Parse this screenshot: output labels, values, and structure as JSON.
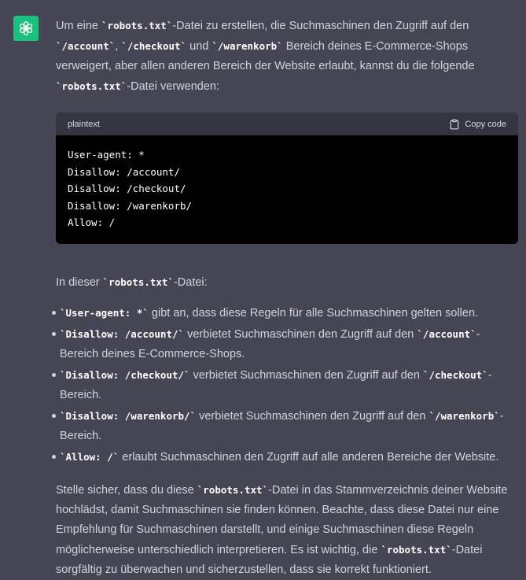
{
  "message": {
    "intro": {
      "t1": "Um eine ",
      "c1": "`robots.txt`",
      "t2": "-Datei zu erstellen, die Suchmaschinen den Zugriff auf den ",
      "c2": "`/account`",
      "t3": ", ",
      "c3": "`/checkout`",
      "t4": " und ",
      "c4": "`/warenkorb`",
      "t5": " Bereich deines E-Commerce-Shops verweigert, aber allen anderen Bereich der Website erlaubt, kannst du die folgende ",
      "c5": "`robots.txt`",
      "t6": "-Datei verwenden:"
    },
    "code_block": {
      "language": "plaintext",
      "copy_label": "Copy code",
      "code": "User-agent: *\nDisallow: /account/\nDisallow: /checkout/\nDisallow: /warenkorb/\nAllow: /"
    },
    "p2": {
      "t1": "In dieser ",
      "c1": "`robots.txt`",
      "t2": "-Datei:"
    },
    "bullets": [
      {
        "code": "`User-agent: *`",
        "text": " gibt an, dass diese Regeln für alle Suchmaschinen gelten sollen."
      },
      {
        "code": "`Disallow: /account/`",
        "text": " verbietet Suchmaschinen den Zugriff auf den ",
        "code2": "`/account`",
        "text2": "-Bereich deines E-Commerce-Shops."
      },
      {
        "code": "`Disallow: /checkout/`",
        "text": " verbietet Suchmaschinen den Zugriff auf den ",
        "code2": "`/checkout`",
        "text2": "-Bereich."
      },
      {
        "code": "`Disallow: /warenkorb/`",
        "text": " verbietet Suchmaschinen den Zugriff auf den ",
        "code2": "`/warenkorb`",
        "text2": "-Bereich."
      },
      {
        "code": "`Allow: /`",
        "text": " erlaubt Suchmaschinen den Zugriff auf alle anderen Bereiche der Website."
      }
    ],
    "p3": {
      "t1": "Stelle sicher, dass du diese ",
      "c1": "`robots.txt`",
      "t2": "-Datei in das Stammverzeichnis deiner Website hochlädst, damit Suchmaschinen sie finden können. Beachte, dass diese Datei nur eine Empfehlung für Suchmaschinen darstellt, und einige Suchmaschinen diese Regeln möglicherweise unterschiedlich interpretieren. Es ist wichtig, die ",
      "c2": "`robots.txt`",
      "t3": "-Datei sorgfältig zu überwachen und sicherzustellen, dass sie korrekt funktioniert."
    }
  },
  "colors": {
    "background": "#444654",
    "avatar": "#19c37d",
    "text": "#d1d5db",
    "code_bg": "#000000",
    "code_header_bg": "#343541"
  },
  "icons": {
    "avatar": "openai-logo-icon",
    "copy": "clipboard-icon"
  }
}
